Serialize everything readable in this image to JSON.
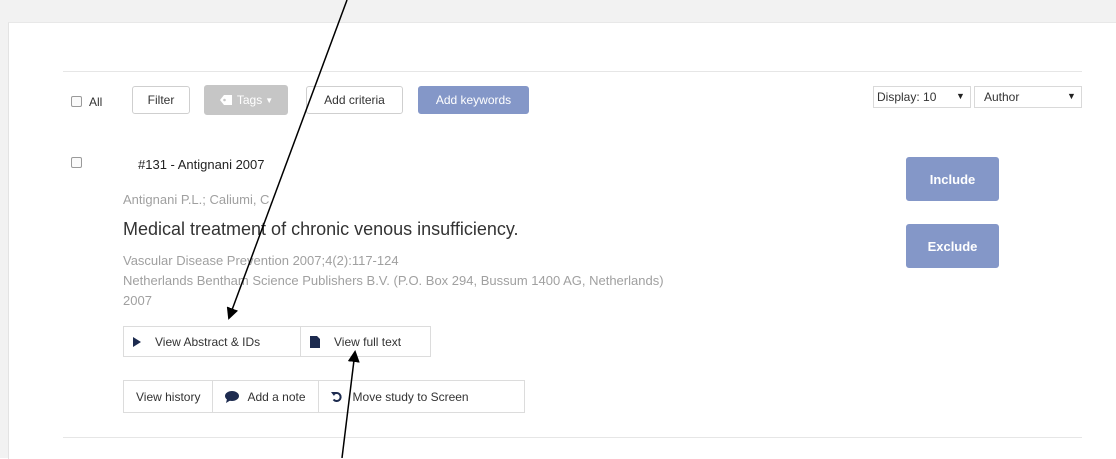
{
  "toolbar": {
    "all_label": "All",
    "filter_label": "Filter",
    "tags_label": "Tags",
    "add_criteria_label": "Add criteria",
    "add_keywords_label": "Add keywords",
    "display_label": "Display: 10",
    "sort_label": "Author"
  },
  "study": {
    "id_title": "#131 - Antignani 2007",
    "authors": "Antignani P.L.; Caliumi, C.",
    "title": "Medical treatment of chronic venous insufficiency.",
    "journal": "Vascular Disease Prevention 2007;4(2):117-124",
    "publisher": "Netherlands Bentham Science Publishers B.V. (P.O. Box 294, Bussum 1400 AG, Netherlands)",
    "year": "2007",
    "include_label": "Include",
    "exclude_label": "Exclude",
    "view_abstract_label": "View Abstract & IDs",
    "view_full_text_label": "View full text",
    "view_history_label": "View history",
    "add_note_label": "Add a note",
    "move_study_label": "Move study to Screen"
  },
  "colors": {
    "primary": "#8497c8",
    "muted_text": "#a0a0a0",
    "disabled": "#c6c6c6"
  }
}
